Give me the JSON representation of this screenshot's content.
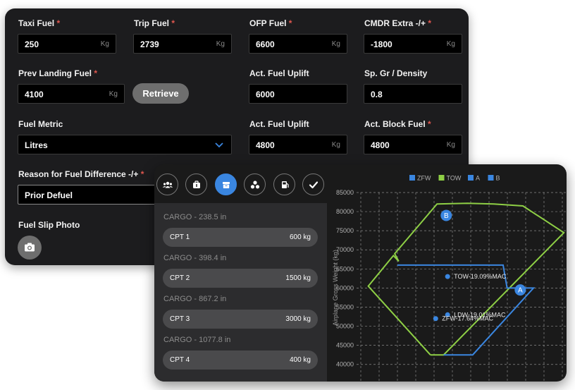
{
  "fuel_form": {
    "taxi_fuel": {
      "label": "Taxi Fuel",
      "req": "*",
      "value": "250",
      "unit": "Kg"
    },
    "trip_fuel": {
      "label": "Trip Fuel",
      "req": "*",
      "value": "2739",
      "unit": "Kg"
    },
    "ofp_fuel": {
      "label": "OFP Fuel",
      "req": "*",
      "value": "6600",
      "unit": "Kg"
    },
    "cmdr_extra": {
      "label": "CMDR Extra -/+",
      "req": "*",
      "value": "-1800",
      "unit": "Kg"
    },
    "prev_landing_fuel": {
      "label": "Prev Landing Fuel",
      "req": "*",
      "value": "4100",
      "unit": "Kg"
    },
    "retrieve_label": "Retrieve",
    "act_fuel_uplift_1": {
      "label": "Act. Fuel Uplift",
      "value": "6000"
    },
    "sp_gr_density": {
      "label": "Sp. Gr / Density",
      "value": "0.8"
    },
    "fuel_metric": {
      "label": "Fuel Metric",
      "value": "Litres"
    },
    "act_fuel_uplift_2": {
      "label": "Act. Fuel Uplift",
      "value": "4800",
      "unit": "Kg"
    },
    "act_block_fuel": {
      "label": "Act. Block Fuel",
      "req": "*",
      "value": "4800",
      "unit": "Kg"
    },
    "reason": {
      "label": "Reason for Fuel Difference -/+",
      "req": "*",
      "value": "Prior Defuel"
    },
    "slip_photo": {
      "label": "Fuel Slip Photo"
    }
  },
  "tabs": [
    {
      "icon": "passengers-icon",
      "active": false
    },
    {
      "icon": "baggage-icon",
      "active": false
    },
    {
      "icon": "cargo-icon",
      "active": true
    },
    {
      "icon": "weights-icon",
      "active": false
    },
    {
      "icon": "fuel-icon",
      "active": false
    },
    {
      "icon": "check-icon",
      "active": false
    }
  ],
  "cargo": [
    {
      "header": "CARGO - 238.5 in",
      "name": "CPT 1",
      "weight": "600 kg"
    },
    {
      "header": "CARGO - 398.4 in",
      "name": "CPT 2",
      "weight": "1500 kg"
    },
    {
      "header": "CARGO - 867.2 in",
      "name": "CPT 3",
      "weight": "3000 kg"
    },
    {
      "header": "CARGO - 1077.8 in",
      "name": "CPT 4",
      "weight": "400 kg"
    }
  ],
  "colors": {
    "accent": "#3a86e0",
    "tow": "#8ecf45",
    "zfw": "#3a86e0",
    "required": "#e0574f"
  },
  "chart_data": {
    "type": "line",
    "ylabel": "Airplane Gross Weight (kg)",
    "yticks": [
      "85000",
      "80000",
      "75000",
      "70000",
      "65000",
      "60000",
      "55000",
      "50000",
      "45000",
      "40000"
    ],
    "ylim": [
      40000,
      85000
    ],
    "grid": true,
    "legend_position": "top",
    "legend": [
      {
        "name": "ZFW",
        "color": "#3a86e0"
      },
      {
        "name": "TOW",
        "color": "#8ecf45"
      },
      {
        "name": "A",
        "color": "#3a86e0"
      },
      {
        "name": "B",
        "color": "#3a86e0"
      }
    ],
    "series": [
      {
        "name": "TOW",
        "color": "#8ecf45",
        "points": [
          [
            -3.8,
            42500
          ],
          [
            -2.8,
            42500
          ],
          [
            6.3,
            74500
          ],
          [
            3.2,
            81500
          ],
          [
            1.0,
            82000
          ],
          [
            -1.0,
            82200
          ],
          [
            -3.3,
            82000
          ],
          [
            -6.5,
            69000
          ],
          [
            -6.2,
            67000
          ],
          [
            -6.6,
            68500
          ],
          [
            -8.5,
            60500
          ],
          [
            -3.8,
            42500
          ]
        ]
      },
      {
        "name": "ZFW",
        "color": "#3a86e0",
        "points": [
          [
            -2.8,
            42500
          ],
          [
            -0.6,
            42500
          ],
          [
            4.0,
            60000
          ],
          [
            2.0,
            60000
          ],
          [
            1.7,
            66000
          ],
          [
            -6.3,
            66000
          ]
        ]
      }
    ],
    "markers": [
      {
        "label": "B",
        "x": -2.6,
        "y": 79000
      },
      {
        "label": "A",
        "x": 3.0,
        "y": 59500
      }
    ],
    "points": [
      {
        "label": "TOW-19.09%MAC",
        "x": -2.5,
        "y": 63000
      },
      {
        "label": "LDW-19.01%MAC",
        "x": -2.5,
        "y": 53000
      },
      {
        "label": "ZFW-17.64%MAC",
        "x": -3.4,
        "y": 52000
      }
    ],
    "xlim": [
      -9.6,
      6.5
    ]
  }
}
